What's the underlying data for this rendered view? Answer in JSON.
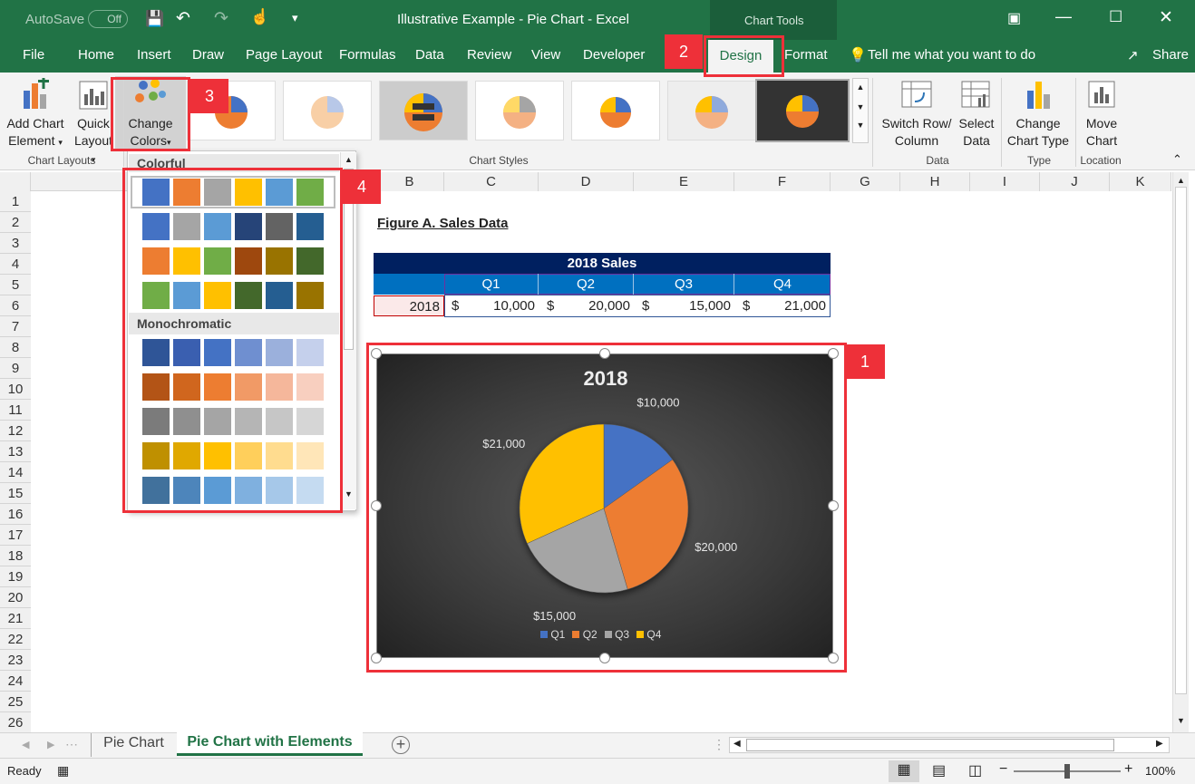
{
  "titlebar": {
    "autosave": "AutoSave",
    "autosave_state": "Off",
    "doc_title": "Illustrative Example - Pie Chart  -  Excel",
    "chart_tools": "Chart Tools"
  },
  "tabs": [
    "File",
    "Home",
    "Insert",
    "Draw",
    "Page Layout",
    "Formulas",
    "Data",
    "Review",
    "View",
    "Developer",
    "Design",
    "Format"
  ],
  "tellme": "Tell me what you want to do",
  "share": "Share",
  "ribbon": {
    "add_chart_1": "Add Chart",
    "add_chart_2": "Element",
    "quick_1": "Quick",
    "quick_2": "Layout",
    "change_colors_1": "Change",
    "change_colors_2": "Colors",
    "chart_layouts": "Chart Layouts",
    "chart_styles": "Chart Styles",
    "switch_1": "Switch Row/",
    "switch_2": "Column",
    "select_1": "Select",
    "select_2": "Data",
    "data_group": "Data",
    "change_type_1": "Change",
    "change_type_2": "Chart Type",
    "type_group": "Type",
    "move_1": "Move",
    "move_2": "Chart",
    "location_group": "Location"
  },
  "callouts": [
    "1",
    "2",
    "3",
    "4"
  ],
  "colors_panel": {
    "colorful": "Colorful",
    "monochromatic": "Monochromatic",
    "colorful_rows": [
      [
        "#4472c4",
        "#ed7d31",
        "#a5a5a5",
        "#ffc000",
        "#5b9bd5",
        "#70ad47"
      ],
      [
        "#4472c4",
        "#a5a5a5",
        "#5b9bd5",
        "#264478",
        "#636363",
        "#255e91"
      ],
      [
        "#ed7d31",
        "#ffc000",
        "#70ad47",
        "#9e480e",
        "#997300",
        "#43682b"
      ],
      [
        "#70ad47",
        "#5b9bd5",
        "#ffc000",
        "#43682b",
        "#255e91",
        "#997300"
      ]
    ],
    "mono_rows": [
      [
        "#2f5597",
        "#3a5fb0",
        "#4472c4",
        "#6f8fd0",
        "#9bb0dc",
        "#c5d0ec"
      ],
      [
        "#b35416",
        "#d0661e",
        "#ed7d31",
        "#f19a66",
        "#f5b79b",
        "#f8cfbf"
      ],
      [
        "#7b7b7b",
        "#8f8f8f",
        "#a5a5a5",
        "#b5b5b5",
        "#c6c6c6",
        "#d6d6d6"
      ],
      [
        "#bf9000",
        "#e0a800",
        "#ffc000",
        "#ffcf5b",
        "#ffdc8f",
        "#ffe6b8"
      ],
      [
        "#41719c",
        "#4d85bb",
        "#5b9bd5",
        "#7fb0df",
        "#a6c8e9",
        "#c5dbf1"
      ]
    ]
  },
  "columns": [
    "B",
    "C",
    "D",
    "E",
    "F",
    "G",
    "H",
    "I",
    "J",
    "K"
  ],
  "rows": [
    "1",
    "2",
    "3",
    "4",
    "5",
    "6",
    "7",
    "8",
    "9",
    "10",
    "11",
    "12",
    "13",
    "14",
    "15",
    "16",
    "17",
    "18",
    "19",
    "20",
    "21",
    "22",
    "23",
    "24",
    "25",
    "26"
  ],
  "figure_title": "Figure A. Sales Data",
  "table": {
    "header": "2018 Sales",
    "quarters": [
      "Q1",
      "Q2",
      "Q3",
      "Q4"
    ],
    "row_label": "2018",
    "currency": "$",
    "values": [
      "10,000",
      "20,000",
      "15,000",
      "21,000"
    ]
  },
  "chart_data": {
    "type": "pie",
    "title": "2018",
    "categories": [
      "Q1",
      "Q2",
      "Q3",
      "Q4"
    ],
    "values": [
      10000,
      20000,
      15000,
      21000
    ],
    "data_labels": [
      "$10,000",
      "$20,000",
      "$15,000",
      "$21,000"
    ],
    "colors": [
      "#4472c4",
      "#ed7d31",
      "#a5a5a5",
      "#ffc000"
    ],
    "legend": "bottom"
  },
  "sheets": {
    "tab1": "Pie Chart",
    "tab2": "Pie Chart with Elements"
  },
  "status": {
    "ready": "Ready",
    "zoom": "100%",
    "minus": "−",
    "plus": "+"
  }
}
